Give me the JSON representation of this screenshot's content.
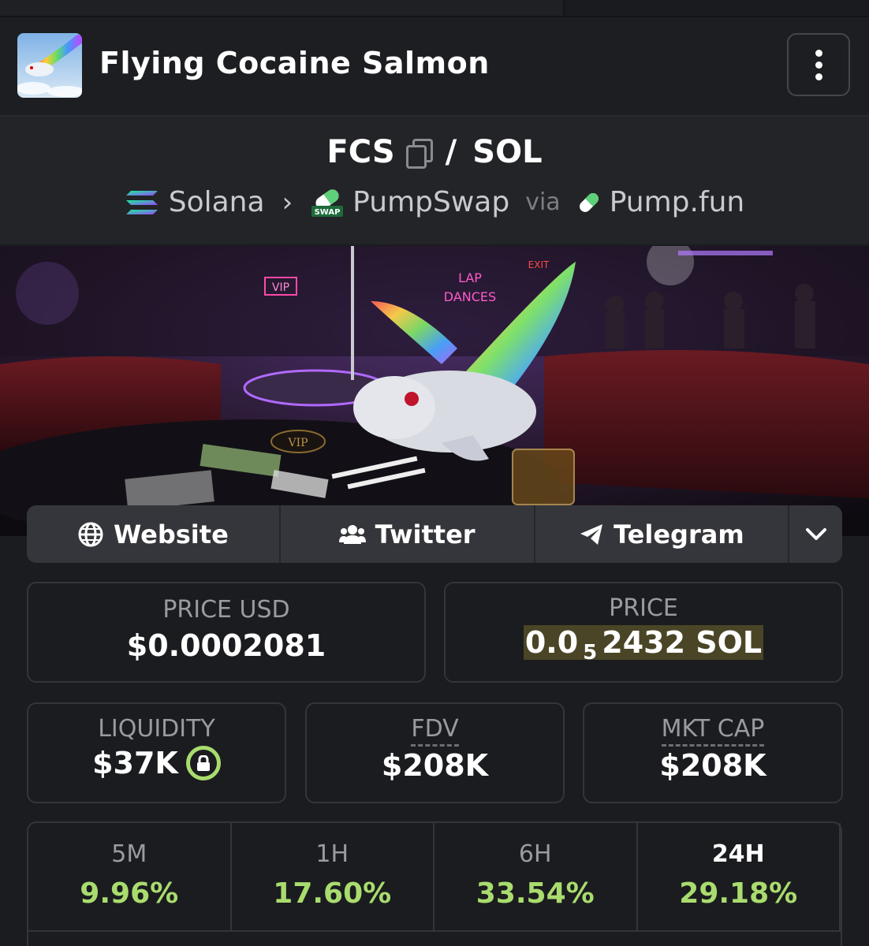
{
  "token": {
    "name": "Flying Cocaine Salmon",
    "base": "FCS",
    "quote": "SOL",
    "separator": "/"
  },
  "route": {
    "chain": "Solana",
    "dex": "PumpSwap",
    "via_label": "via",
    "launchpad": "Pump.fun",
    "swap_badge": "SWAP"
  },
  "links": {
    "website": "Website",
    "twitter": "Twitter",
    "telegram": "Telegram"
  },
  "stats": {
    "price_usd_label": "PRICE USD",
    "price_usd": "$0.0002081",
    "price_label": "PRICE",
    "price_prefix": "0.0",
    "price_zero_count": "5",
    "price_digits": "2432 SOL",
    "liquidity_label": "LIQUIDITY",
    "liquidity": "$37K",
    "fdv_label": "FDV",
    "fdv": "$208K",
    "mcap_label": "MKT CAP",
    "mcap": "$208K"
  },
  "timeframes": [
    {
      "label": "5M",
      "change": "9.96%"
    },
    {
      "label": "1H",
      "change": "17.60%"
    },
    {
      "label": "6H",
      "change": "33.54%"
    },
    {
      "label": "24H",
      "change": "29.18%"
    }
  ],
  "banner_signs": {
    "vip": "VIP",
    "lap": "LAP",
    "dances": "DANCES",
    "exit": "EXIT",
    "table_vip": "VIP"
  },
  "colors": {
    "accent_green": "#a9dc6e",
    "price_highlight": "#4a4526"
  }
}
